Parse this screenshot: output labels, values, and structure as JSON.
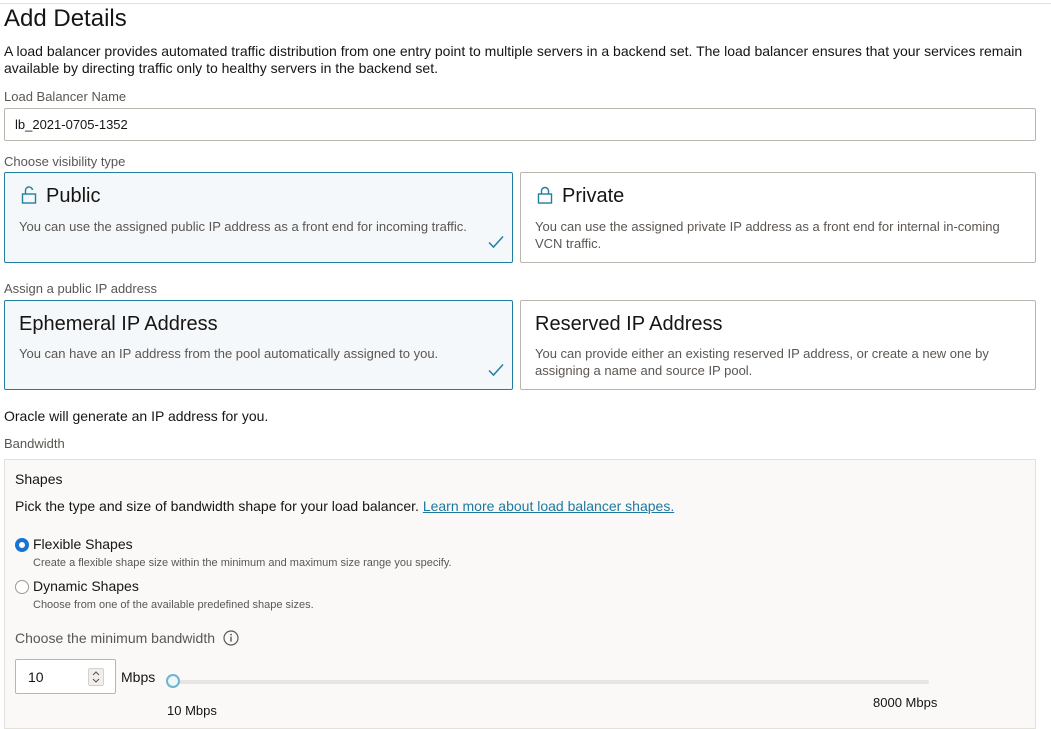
{
  "page": {
    "title": "Add Details",
    "intro": "A load balancer provides automated traffic distribution from one entry point to multiple servers in a backend set. The load balancer ensures that your services remain available by directing traffic only to healthy servers in the backend set."
  },
  "name_field": {
    "label": "Load Balancer Name",
    "value": "lb_2021-0705-1352"
  },
  "visibility": {
    "label": "Choose visibility type",
    "selected": "public",
    "options": [
      {
        "id": "public",
        "title": "Public",
        "icon": "lock-open-icon",
        "description": "You can use the assigned public IP address as a front end for incoming traffic."
      },
      {
        "id": "private",
        "title": "Private",
        "icon": "lock-icon",
        "description": "You can use the assigned private IP address as a front end for internal in-coming VCN traffic."
      }
    ]
  },
  "public_ip": {
    "label": "Assign a public IP address",
    "selected": "ephemeral",
    "options": [
      {
        "id": "ephemeral",
        "title": "Ephemeral IP Address",
        "description": "You can have an IP address from the pool automatically assigned to you."
      },
      {
        "id": "reserved",
        "title": "Reserved IP Address",
        "description": "You can provide either an existing reserved IP address, or create a new one by assigning a name and source IP pool."
      }
    ],
    "note": "Oracle will generate an IP address for you."
  },
  "bandwidth": {
    "label": "Bandwidth",
    "shapes_title": "Shapes",
    "shapes_description": "Pick the type and size of bandwidth shape for your load balancer.",
    "learn_more_link": "Learn more about load balancer shapes.",
    "shape_options": [
      {
        "id": "flexible",
        "label": "Flexible Shapes",
        "help": "Create a flexible shape size within the minimum and maximum size range you specify.",
        "checked": true
      },
      {
        "id": "dynamic",
        "label": "Dynamic Shapes",
        "help": "Choose from one of the available predefined shape sizes.",
        "checked": false
      }
    ],
    "min_label": "Choose the minimum bandwidth",
    "min_value": "10",
    "unit": "Mbps",
    "slider_min_label": "10 Mbps",
    "slider_max_label": "8000 Mbps",
    "slider_value": 10,
    "slider_range": [
      10,
      8000
    ]
  },
  "colors": {
    "accent": "#227e9e",
    "check": "#227e9e",
    "link": "#1c7aa1",
    "radio_selected": "#1a73d4"
  }
}
